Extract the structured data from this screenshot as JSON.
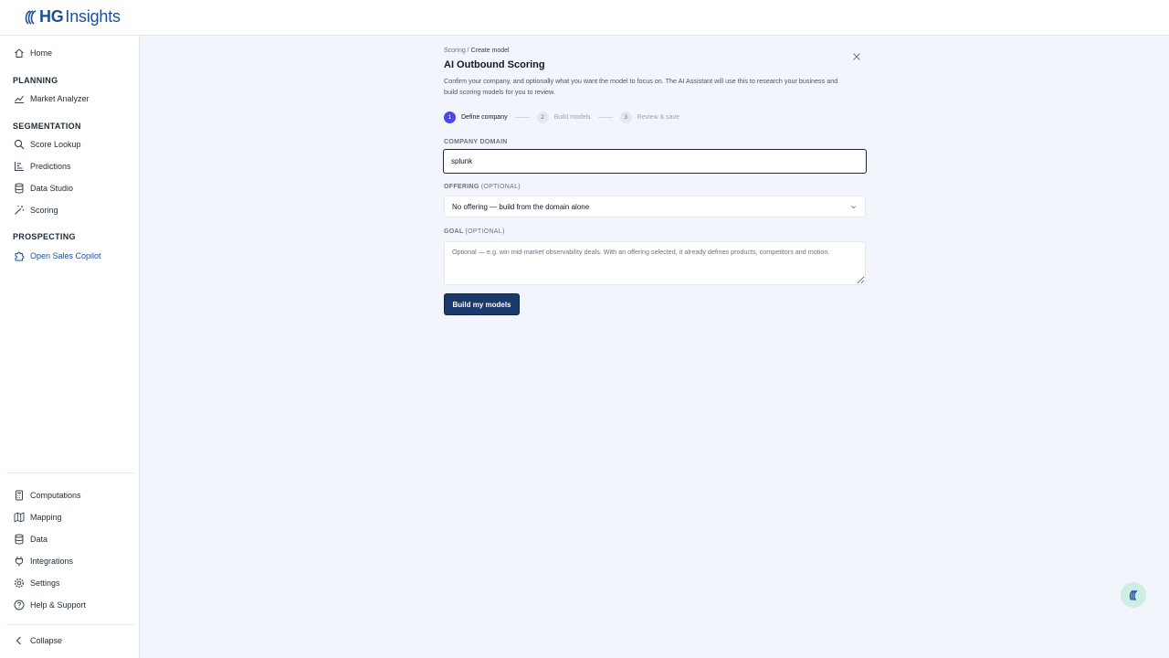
{
  "brand": {
    "hg": "HG",
    "insights": "Insights"
  },
  "sidebar": {
    "home": "Home",
    "sections": [
      "PLANNING",
      "SEGMENTATION",
      "PROSPECTING"
    ],
    "market_analyzer": "Market Analyzer",
    "score_lookup": "Score Lookup",
    "predictions": "Predictions",
    "data_studio": "Data Studio",
    "scoring": "Scoring",
    "open_sales_copilot": "Open Sales Copilot",
    "computations": "Computations",
    "mapping": "Mapping",
    "data": "Data",
    "integrations": "Integrations",
    "settings": "Settings",
    "help": "Help & Support",
    "collapse": "Collapse"
  },
  "breadcrumb": {
    "parent": "Scoring",
    "sep": " / ",
    "current": "Create model"
  },
  "page": {
    "title": "AI Outbound Scoring",
    "description": "Confirm your company, and optionally what you want the model to focus on. The AI Assistant will use this to research your business and build scoring models for you to review."
  },
  "steps": [
    {
      "num": "1",
      "label": "Define company"
    },
    {
      "num": "2",
      "label": "Build models"
    },
    {
      "num": "3",
      "label": "Review & save"
    }
  ],
  "form": {
    "domain_label": "COMPANY DOMAIN",
    "domain_value": "splunk",
    "offering_label": "OFFERING",
    "offering_optional": "(OPTIONAL)",
    "offering_value": "No offering — build from the domain alone",
    "goal_label": "GOAL",
    "goal_optional": "(OPTIONAL)",
    "goal_placeholder": "Optional — e.g. win mid-market observability deals. With an offering selected, it already defines products, competitors and motion.",
    "submit": "Build my models"
  },
  "colors": {
    "brand": "#1c4f97",
    "primary_button": "#1b3a6b",
    "step_active": "#4f46e5",
    "fab": "#cdeee2"
  }
}
